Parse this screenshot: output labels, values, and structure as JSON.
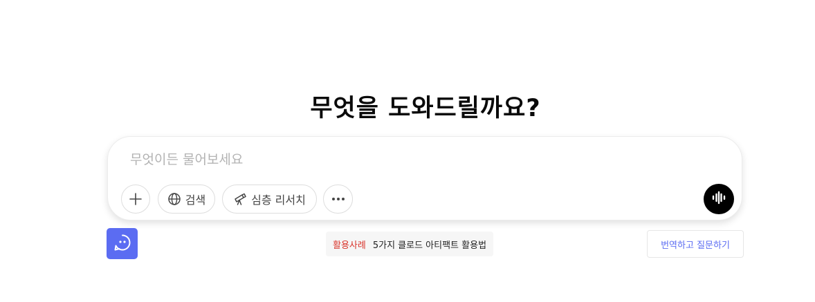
{
  "heading": "무엇을 도와드릴까요?",
  "composer": {
    "placeholder": "무엇이든 물어보세요",
    "value": "",
    "tools": {
      "add_icon": "plus-icon",
      "search_label": "검색",
      "search_icon": "globe-icon",
      "research_label": "심층 리서치",
      "research_icon": "telescope-icon",
      "more_icon": "more-horizontal-icon",
      "voice_icon": "voice-waveform-icon"
    }
  },
  "footer": {
    "usecase_tag": "활용사례",
    "usecase_text": "5가지 클로드 아티팩트 활용법",
    "translate_label": "번역하고 질문하기"
  },
  "colors": {
    "accent": "#5b6cf2",
    "usecase_tag": "#d9342b",
    "voice_button": "#000000"
  }
}
